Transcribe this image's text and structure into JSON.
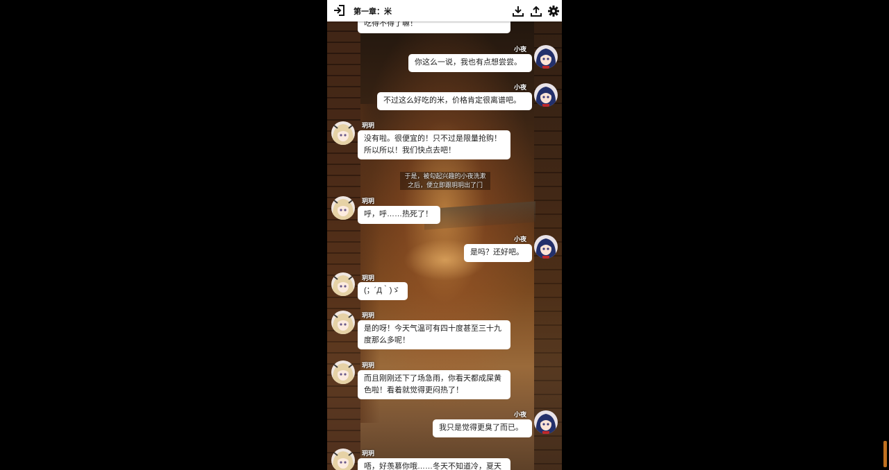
{
  "header": {
    "title": "第一章：米"
  },
  "icons": {
    "exit": "exit-icon",
    "download": "download-icon",
    "upload": "upload-icon",
    "settings": "gear-icon"
  },
  "characters": {
    "left": "玥玥",
    "right": "小夜"
  },
  "messages": [
    {
      "side": "left",
      "name": "",
      "text": "吃得不得了嘛！"
    },
    {
      "side": "right",
      "name": "小夜",
      "text": "你这么一说，我也有点想尝尝。"
    },
    {
      "side": "right",
      "name": "小夜",
      "text": "不过这么好吃的米，价格肯定很离谱吧。"
    },
    {
      "side": "left",
      "name": "玥玥",
      "text": "没有啦。很便宜的！只不过是限量抢购！\n所以所以！我们快点去吧！"
    },
    {
      "side": "left",
      "name": "玥玥",
      "text": "呼，呼……热死了！"
    },
    {
      "side": "right",
      "name": "小夜",
      "text": "是吗？还好吧。"
    },
    {
      "side": "left",
      "name": "玥玥",
      "text": "(；´Д｀)ゞ"
    },
    {
      "side": "left",
      "name": "玥玥",
      "text": "是的呀！今天气温可有四十度甚至三十九\n度那么多呢！"
    },
    {
      "side": "left",
      "name": "玥玥",
      "text": "而且刚刚还下了场急雨，你看天都成屎黄\n色啦！看着就觉得更闷热了！"
    },
    {
      "side": "right",
      "name": "小夜",
      "text": "我只是觉得更臭了而已。"
    },
    {
      "side": "left",
      "name": "玥玥",
      "text": "唔，好羡慕你哦……冬天不知道冷，夏天"
    }
  ],
  "narration": "于是，被勾起兴趣的小夜洗漱\n之后，便立即跟玥玥出了门"
}
